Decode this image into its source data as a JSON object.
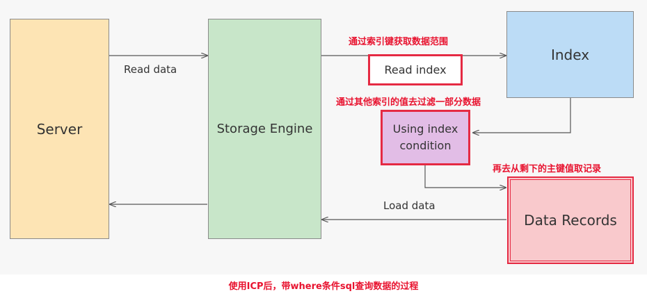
{
  "nodes": {
    "server": "Server",
    "storage_engine": "Storage Engine",
    "index": "Index",
    "data_records": "Data Records",
    "read_index": "Read index",
    "using_index_condition_line1": "Using index",
    "using_index_condition_line2": "condition"
  },
  "edge_labels": {
    "read_data": "Read data",
    "load_data": "Load data"
  },
  "annotations": {
    "range_via_index": "通过索引键获取数据范围",
    "filter_via_other_index": "通过其他索引的值去过滤一部分数据",
    "fetch_remaining_records": "再去从剩下的主键值取记录"
  },
  "caption": "使用ICP后，带where条件sql查询数据的过程",
  "colors": {
    "server_fill": "#fde4b4",
    "engine_fill": "#c8e6c9",
    "index_fill": "#bcdcf6",
    "records_fill": "#f9c9cc",
    "uic_fill": "#e2bde6",
    "highlight": "#e52a43",
    "annotation_text": "#e8132f"
  }
}
